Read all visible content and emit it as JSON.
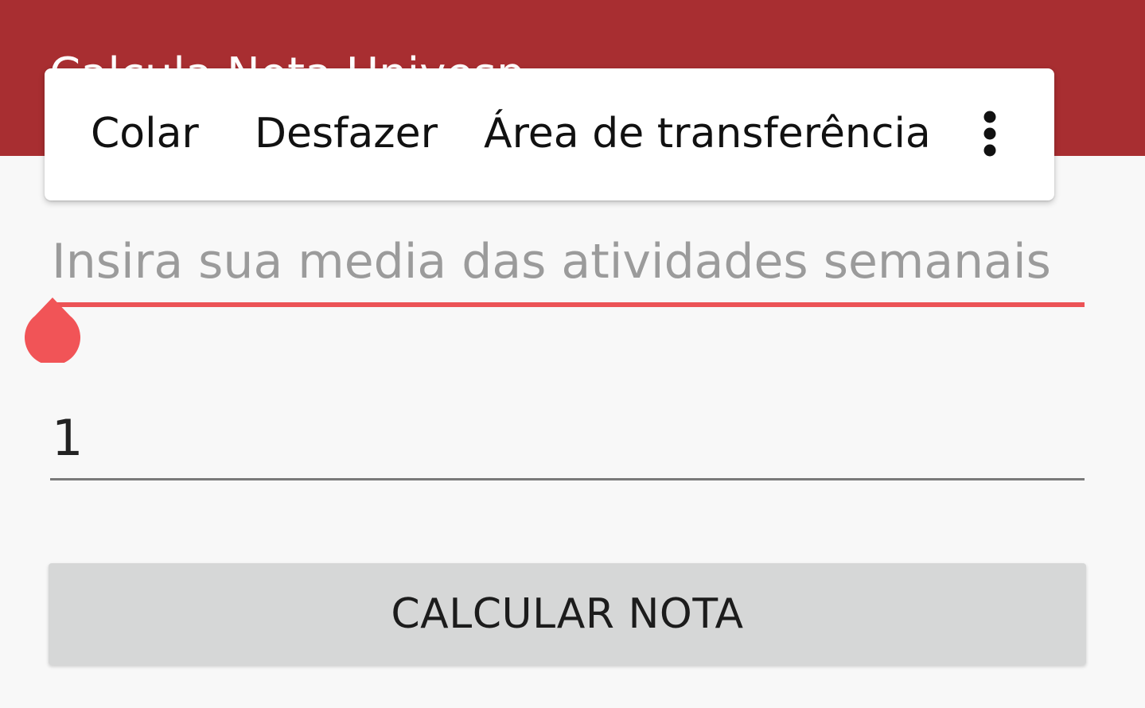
{
  "app_bar": {
    "title": "Calcula Nota Univesp",
    "color": "#a82e31"
  },
  "context_menu": {
    "items": [
      {
        "label": "Colar"
      },
      {
        "label": "Desfazer"
      },
      {
        "label": "Área de transferência"
      }
    ],
    "more_icon": "more-vert-icon"
  },
  "form": {
    "media_field": {
      "value": "",
      "placeholder": "Insira sua media das atividades semanais",
      "accent_color": "#ec5356"
    },
    "cursor_handle_icon": "text-cursor-handle-icon",
    "second_field": {
      "value": "1"
    },
    "calculate_button": {
      "label": "CALCULAR NOTA"
    }
  }
}
